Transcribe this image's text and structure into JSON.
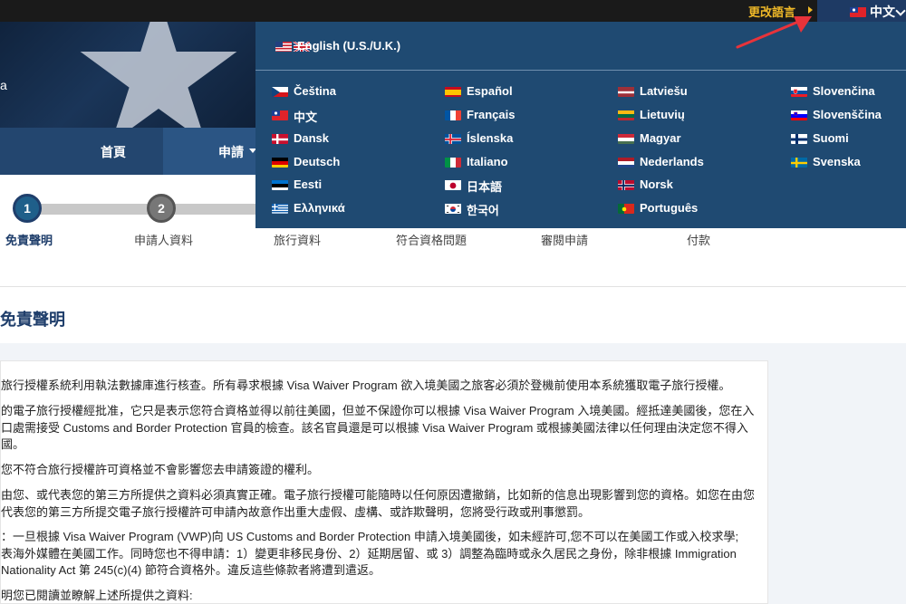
{
  "topbar": {
    "change_language": "更改語言",
    "current_language": "中文"
  },
  "nav": {
    "home": "首頁",
    "apply": "申請"
  },
  "steps": [
    {
      "number": "1",
      "label": "免責聲明"
    },
    {
      "number": "2",
      "label": "申請人資料"
    },
    {
      "label": "旅行資料"
    },
    {
      "label": "符合資格問題"
    },
    {
      "label": "審閱申請"
    },
    {
      "label": "付款"
    }
  ],
  "page_title": "免責聲明",
  "paragraphs": [
    "旅行授權系統利用執法數據庫進行核查。所有尋求根據 Visa Waiver Program 欲入境美國之旅客必須於登機前使用本系統獲取電子旅行授權。",
    "的電子旅行授權經批准，它只是表示您符合資格並得以前往美國，但並不保證你可以根據 Visa Waiver Program 入境美國。經抵達美國後，您在入\n口處需接受 Customs and Border Protection 官員的檢查。該名官員還是可以根據 Visa Waiver Program 或根據美國法律以任何理由決定您不得入\n國。",
    "您不符合旅行授權許可資格並不會影響您去申請簽證的權利。",
    "由您、或代表您的第三方所提供之資料必須真實正確。電子旅行授權可能隨時以任何原因遭撤銷，比如新的信息出現影響到您的資格。如您在由您\n代表您的第三方所提交電子旅行授權許可申請內故意作出重大虛假、虛構、或詐欺聲明，您將受行政或刑事懲罰。",
    "：一旦根據 Visa Waiver Program (VWP)向 US Customs and Border Protection 申請入境美國後，如未經許可,您不可以在美國工作或入校求學;\n表海外媒體在美國工作。同時您也不得申請：1）變更非移民身份、2）延期居留、或 3）調整為臨時或永久居民之身份，除非根據 Immigration\nNationality Act 第 245(c)(4) 節符合資格外。違反這些條款者將遭到遣返。",
    "明您已閱讀並瞭解上述所提供之資料:"
  ],
  "language_menu": {
    "english": {
      "label": "English (U.S./U.K.)",
      "flag": "us-uk-flag"
    },
    "languages": [
      {
        "label": "Čeština",
        "flag": "cz"
      },
      {
        "label": "中文",
        "flag": "tw"
      },
      {
        "label": "Dansk",
        "flag": "dk"
      },
      {
        "label": "Deutsch",
        "flag": "de"
      },
      {
        "label": "Eesti",
        "flag": "ee"
      },
      {
        "label": "Ελληνικά",
        "flag": "gr"
      },
      {
        "label": "Español",
        "flag": "es"
      },
      {
        "label": "Français",
        "flag": "fr"
      },
      {
        "label": "Íslenska",
        "flag": "is"
      },
      {
        "label": "Italiano",
        "flag": "it"
      },
      {
        "label": "日本語",
        "flag": "jp"
      },
      {
        "label": "한국어",
        "flag": "kr"
      },
      {
        "label": "Latviešu",
        "flag": "lv"
      },
      {
        "label": "Lietuvių",
        "flag": "lt"
      },
      {
        "label": "Magyar",
        "flag": "hu"
      },
      {
        "label": "Nederlands",
        "flag": "nl"
      },
      {
        "label": "Norsk",
        "flag": "no"
      },
      {
        "label": "Português",
        "flag": "pt"
      },
      {
        "label": "Slovenčina",
        "flag": "sk"
      },
      {
        "label": "Slovenščina",
        "flag": "si"
      },
      {
        "label": "Suomi",
        "flag": "fi"
      },
      {
        "label": "Svenska",
        "flag": "se"
      }
    ]
  },
  "colors": {
    "accent_yellow": "#f0b928",
    "nav_blue": "#1f3e6b",
    "dropdown_blue": "#1f4a72",
    "annotation_red": "#e8333a"
  }
}
